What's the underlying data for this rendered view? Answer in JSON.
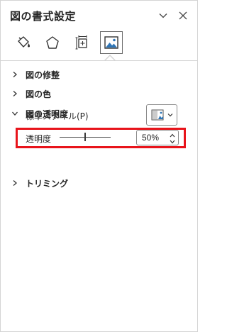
{
  "pane": {
    "title": "図の書式設定",
    "collapse_icon": "chevron-down-icon",
    "close_icon": "close-icon"
  },
  "tabs": [
    {
      "name": "fill-line",
      "icon": "paint-bucket-icon",
      "selected": false
    },
    {
      "name": "effects",
      "icon": "pentagon-icon",
      "selected": false
    },
    {
      "name": "size-properties",
      "icon": "size-layout-icon",
      "selected": false
    },
    {
      "name": "picture",
      "icon": "picture-icon",
      "selected": true
    }
  ],
  "sections": {
    "picture_corrections": {
      "label": "図の修整",
      "expanded": false
    },
    "picture_color": {
      "label": "図の色",
      "expanded": false
    },
    "picture_transparency": {
      "label": "図の透明度",
      "expanded": true
    },
    "crop": {
      "label": "トリミング",
      "expanded": false
    }
  },
  "transparency": {
    "preset_label": "標準スタイル(P)",
    "transparency_label": "透明度",
    "value": "50%",
    "slider_fraction": 0.5
  },
  "colors": {
    "highlight": "#e8141b",
    "accent": "#2e75b6"
  }
}
